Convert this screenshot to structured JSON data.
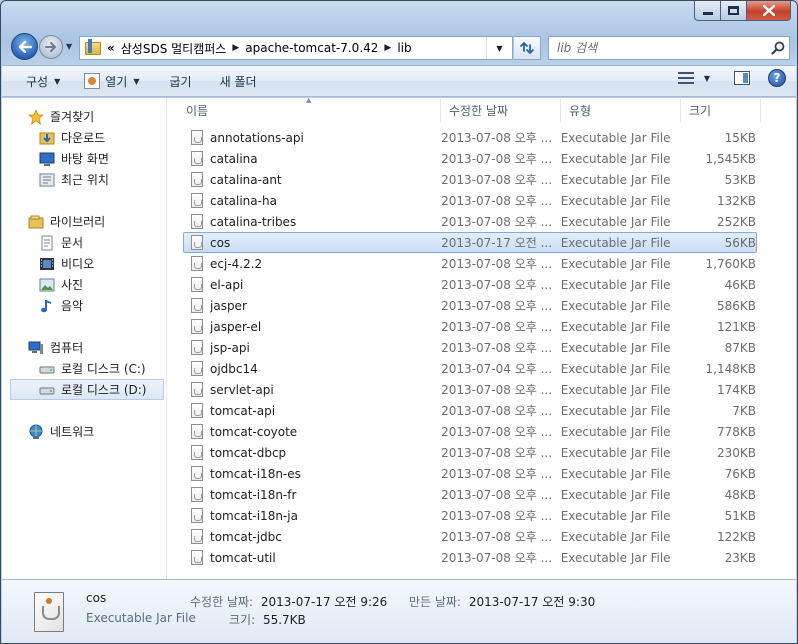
{
  "window": {
    "caption_icons": [
      "minimize-icon",
      "maximize-icon",
      "close-icon"
    ]
  },
  "address": {
    "more_glyph": "«",
    "crumbs": [
      "삼성SDS 멀티캠퍼스",
      "apache-tomcat-7.0.42",
      "lib"
    ],
    "separator": "▶"
  },
  "search": {
    "placeholder": "lib 검색"
  },
  "toolbar": {
    "organize_label": "구성",
    "open_label": "열기",
    "burn_label": "굽기",
    "new_folder_label": "새 폴더",
    "help_label": "?"
  },
  "navpane": {
    "favorites": {
      "label": "즐겨찾기",
      "items": [
        "다운로드",
        "바탕 화면",
        "최근 위치"
      ]
    },
    "libraries": {
      "label": "라이브러리",
      "items": [
        "문서",
        "비디오",
        "사진",
        "음악"
      ]
    },
    "computer": {
      "label": "컴퓨터",
      "items": [
        "로컬 디스크 (C:)",
        "로컬 디스크 (D:)"
      ],
      "selected_index": 1
    },
    "network": {
      "label": "네트워크"
    }
  },
  "columns": {
    "name": "이름",
    "date": "수정한 날짜",
    "type": "유형",
    "size": "크기"
  },
  "files": [
    {
      "name": "annotations-api",
      "date": "2013-07-08 오후 ...",
      "type": "Executable Jar File",
      "size": "15KB"
    },
    {
      "name": "catalina",
      "date": "2013-07-08 오후 ...",
      "type": "Executable Jar File",
      "size": "1,545KB"
    },
    {
      "name": "catalina-ant",
      "date": "2013-07-08 오후 ...",
      "type": "Executable Jar File",
      "size": "53KB"
    },
    {
      "name": "catalina-ha",
      "date": "2013-07-08 오후 ...",
      "type": "Executable Jar File",
      "size": "132KB"
    },
    {
      "name": "catalina-tribes",
      "date": "2013-07-08 오후 ...",
      "type": "Executable Jar File",
      "size": "252KB"
    },
    {
      "name": "cos",
      "date": "2013-07-17 오전 ...",
      "type": "Executable Jar File",
      "size": "56KB"
    },
    {
      "name": "ecj-4.2.2",
      "date": "2013-07-08 오후 ...",
      "type": "Executable Jar File",
      "size": "1,760KB"
    },
    {
      "name": "el-api",
      "date": "2013-07-08 오후 ...",
      "type": "Executable Jar File",
      "size": "46KB"
    },
    {
      "name": "jasper",
      "date": "2013-07-08 오후 ...",
      "type": "Executable Jar File",
      "size": "586KB"
    },
    {
      "name": "jasper-el",
      "date": "2013-07-08 오후 ...",
      "type": "Executable Jar File",
      "size": "121KB"
    },
    {
      "name": "jsp-api",
      "date": "2013-07-08 오후 ...",
      "type": "Executable Jar File",
      "size": "87KB"
    },
    {
      "name": "ojdbc14",
      "date": "2013-07-04 오후 ...",
      "type": "Executable Jar File",
      "size": "1,148KB"
    },
    {
      "name": "servlet-api",
      "date": "2013-07-08 오후 ...",
      "type": "Executable Jar File",
      "size": "174KB"
    },
    {
      "name": "tomcat-api",
      "date": "2013-07-08 오후 ...",
      "type": "Executable Jar File",
      "size": "7KB"
    },
    {
      "name": "tomcat-coyote",
      "date": "2013-07-08 오후 ...",
      "type": "Executable Jar File",
      "size": "778KB"
    },
    {
      "name": "tomcat-dbcp",
      "date": "2013-07-08 오후 ...",
      "type": "Executable Jar File",
      "size": "230KB"
    },
    {
      "name": "tomcat-i18n-es",
      "date": "2013-07-08 오후 ...",
      "type": "Executable Jar File",
      "size": "76KB"
    },
    {
      "name": "tomcat-i18n-fr",
      "date": "2013-07-08 오후 ...",
      "type": "Executable Jar File",
      "size": "48KB"
    },
    {
      "name": "tomcat-i18n-ja",
      "date": "2013-07-08 오후 ...",
      "type": "Executable Jar File",
      "size": "51KB"
    },
    {
      "name": "tomcat-jdbc",
      "date": "2013-07-08 오후 ...",
      "type": "Executable Jar File",
      "size": "122KB"
    },
    {
      "name": "tomcat-util",
      "date": "2013-07-08 오후 ...",
      "type": "Executable Jar File",
      "size": "23KB"
    }
  ],
  "selected_file_index": 5,
  "details": {
    "name": "cos",
    "type": "Executable Jar File",
    "modified_label": "수정한 날짜:",
    "modified_value": "2013-07-17 오전 9:26",
    "created_label": "만든 날짜:",
    "created_value": "2013-07-17 오전 9:30",
    "size_label": "크기:",
    "size_value": "55.7KB"
  },
  "colors": {
    "selection_fill": "#c9def7",
    "selection_border": "#86a9d8",
    "secondary_text": "#6d6d6d"
  }
}
